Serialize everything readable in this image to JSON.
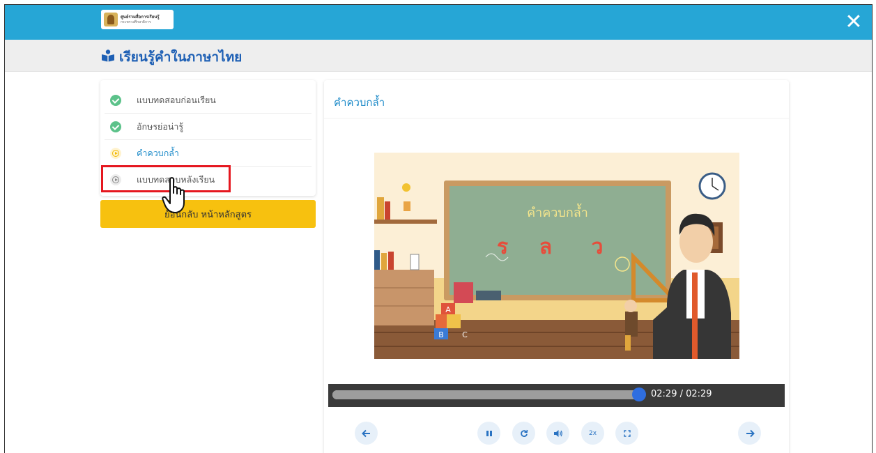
{
  "topbar": {
    "logo_line1": "ศูนย์รวมสื่อการเรียนรู้",
    "logo_line2": "กระทรวงศึกษาธิการ",
    "close_label": "✕"
  },
  "header": {
    "title": "เรียนรู้คำในภาษาไทย"
  },
  "sidebar": {
    "items": [
      {
        "label": "แบบทดสอบก่อนเรียน",
        "status": "done"
      },
      {
        "label": "อักษรย่อน่ารู้",
        "status": "done"
      },
      {
        "label": "คำควบกล้ำ",
        "status": "playing"
      },
      {
        "label": "แบบทดสอบหลังเรียน",
        "status": "idle"
      }
    ],
    "back_button": "ย้อนกลับ หน้าหลักสูตร"
  },
  "content": {
    "title": "คำควบกล้ำ",
    "board_title": "คำควบกล้ำ",
    "board_letters": [
      "ร",
      "ล",
      "ว"
    ],
    "blocks": [
      "A",
      "B",
      "C"
    ]
  },
  "player": {
    "time": "02:29 / 02:29",
    "progress": 1.0,
    "speed_label": "2x"
  },
  "colors": {
    "topbar": "#26a6d6",
    "accent": "#1e8bc9",
    "title": "#1d5fb4",
    "back_button": "#f7c10f",
    "highlight": "#e5171f",
    "progress_knob": "#2f6ee0"
  }
}
